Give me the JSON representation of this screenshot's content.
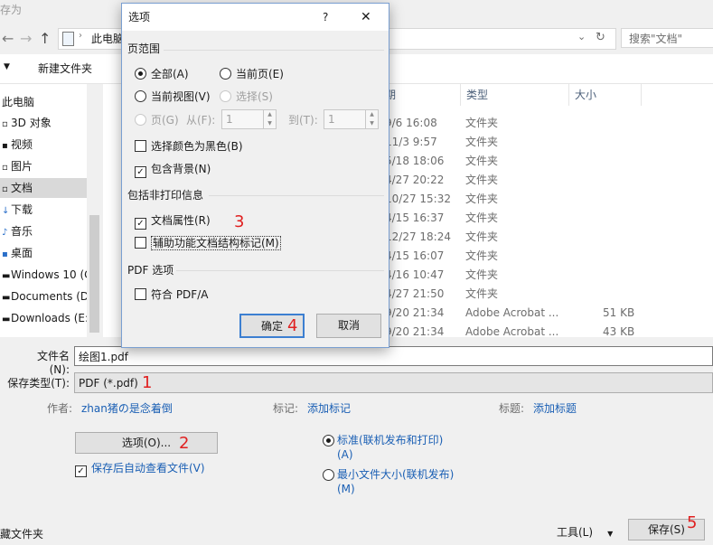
{
  "window": {
    "title": "存为"
  },
  "toolbar": {
    "back": "←",
    "forward": "→",
    "up": "↑",
    "breadcrumb": "此电脑",
    "search_placeholder": "搜索\"文档\""
  },
  "cmdbar": {
    "new_folder": "新建文件夹"
  },
  "nav": {
    "items": [
      {
        "label": "此电脑"
      },
      {
        "label": "3D 对象"
      },
      {
        "label": "视频"
      },
      {
        "label": "图片"
      },
      {
        "label": "文档"
      },
      {
        "label": "下载"
      },
      {
        "label": "音乐"
      },
      {
        "label": "桌面"
      },
      {
        "label": "Windows 10 (C"
      },
      {
        "label": "Documents (D:"
      },
      {
        "label": "Downloads (E:)"
      }
    ]
  },
  "list": {
    "headers": {
      "date": "期",
      "type": "类型",
      "size": "大小"
    },
    "rows": [
      {
        "date": "9/6 16:08",
        "type": "文件夹",
        "size": ""
      },
      {
        "date": "11/3 9:57",
        "type": "文件夹",
        "size": ""
      },
      {
        "date": "5/18 18:06",
        "type": "文件夹",
        "size": ""
      },
      {
        "date": "4/27 20:22",
        "type": "文件夹",
        "size": ""
      },
      {
        "date": "10/27 15:32",
        "type": "文件夹",
        "size": ""
      },
      {
        "date": "4/15 16:37",
        "type": "文件夹",
        "size": ""
      },
      {
        "date": "12/27 18:24",
        "type": "文件夹",
        "size": ""
      },
      {
        "date": "4/15 16:07",
        "type": "文件夹",
        "size": ""
      },
      {
        "date": "4/16 10:47",
        "type": "文件夹",
        "size": ""
      },
      {
        "date": "4/27 21:50",
        "type": "文件夹",
        "size": ""
      },
      {
        "date": "9/20 21:34",
        "type": "Adobe Acrobat ...",
        "size": "51 KB"
      },
      {
        "date": "9/20 21:34",
        "type": "Adobe Acrobat ...",
        "size": "43 KB"
      }
    ]
  },
  "form": {
    "filename_label": "文件名(N):",
    "filename_value": "绘图1.pdf",
    "filetype_label": "保存类型(T):",
    "filetype_value": "PDF (*.pdf)",
    "author_label": "作者:",
    "author_value": "zhan猪の是念着倒",
    "tags_label": "标记:",
    "tags_value": "添加标记",
    "title_label": "标题:",
    "title_value": "添加标题",
    "options_button": "选项(O)...",
    "open_after_label": "保存后自动查看文件(V)",
    "radio_standard": "标准(联机发布和打印)(A)",
    "radio_minimum": "最小文件大小(联机发布)(M)",
    "hide_folders": "藏文件夹",
    "tools_button": "工具(L)",
    "save_button": "保存(S)",
    "markers": {
      "m1": "1",
      "m2": "2",
      "m5": "5"
    }
  },
  "dialog": {
    "title": "选项",
    "help": "?",
    "close": "✕",
    "page_range_label": "页范围",
    "all": "全部(A)",
    "current_page": "当前页(E)",
    "current_view": "当前视图(V)",
    "selection": "选择(S)",
    "pages": "页(G)",
    "from": "从(F):",
    "from_value": "1",
    "to": "到(T):",
    "to_value": "1",
    "black_white": "选择颜色为黑色(B)",
    "include_background": "包含背景(N)",
    "nonprint_label": "包括非打印信息",
    "doc_properties": "文档属性(R)",
    "accessibility": "辅助功能文档结构标记(M)",
    "pdf_options_label": "PDF 选项",
    "pdfa": "符合 PDF/A",
    "ok": "确定",
    "cancel": "取消",
    "markers": {
      "m3": "3",
      "m4": "4"
    }
  }
}
